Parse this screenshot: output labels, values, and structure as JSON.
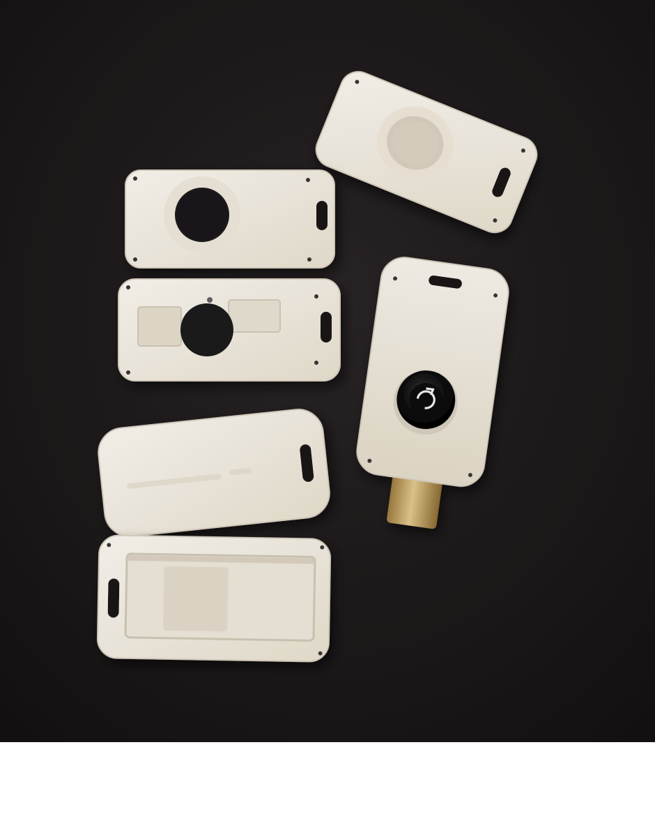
{
  "scene": {
    "background_color": "#1f1b1c",
    "part_color": "#f1ece1",
    "part_shadow_color": "#d9d1c2",
    "lens_color": "#101010",
    "connector_color": "#c8a55a",
    "lower_margin_color": "#ffffff"
  },
  "icons": {
    "lens": "camera-lens-icon",
    "connector": "usb-c-connector-icon",
    "lanyard_slot": "lanyard-slot-icon"
  }
}
